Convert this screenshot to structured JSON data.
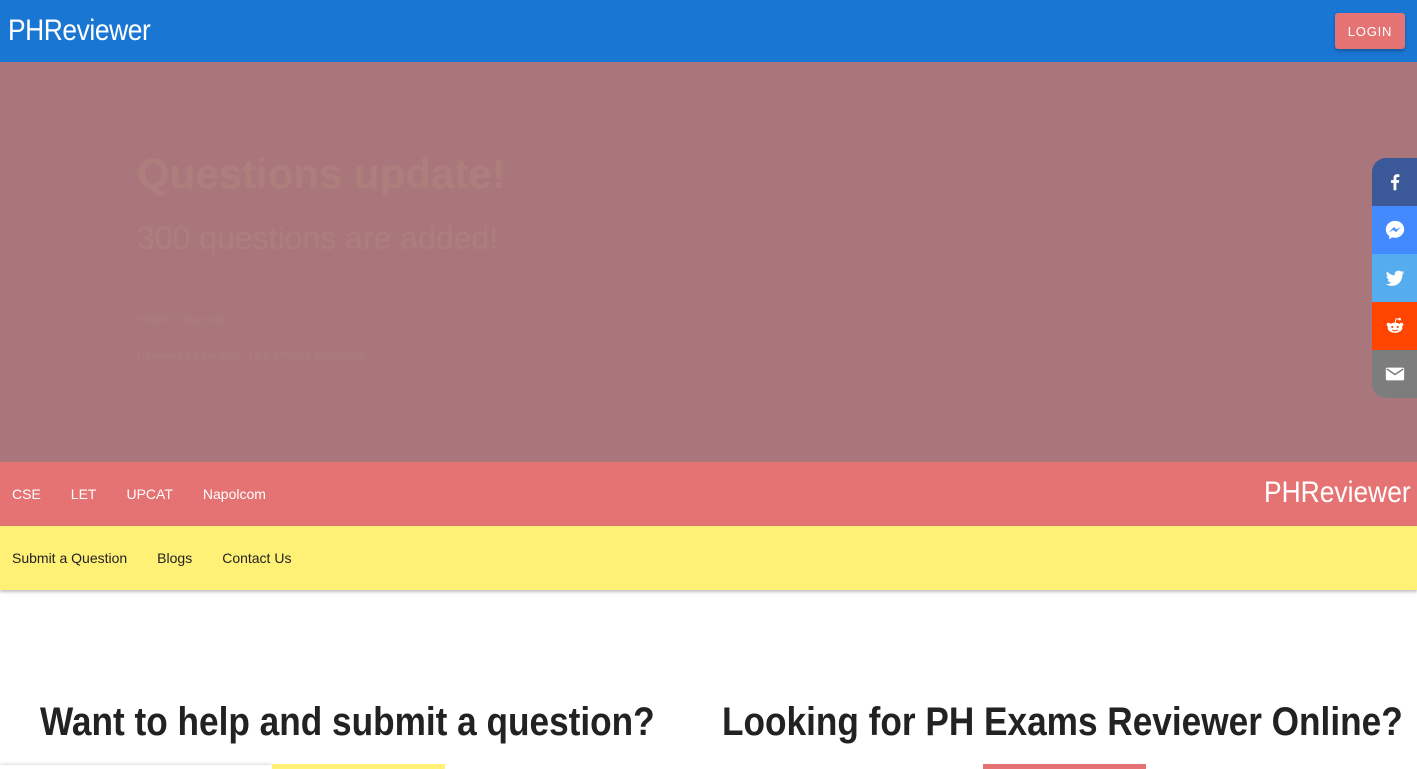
{
  "appbar": {
    "brand": "PHReviewer",
    "login_label": "LOGIN"
  },
  "hero": {
    "title": "Questions update!",
    "subtitle": "300 questions are added!",
    "line1": "Posted 2 days ago",
    "line2": "Reviewer for the CSE, LET, UPCAT, Napolcom"
  },
  "share": [
    {
      "name": "facebook",
      "color": "#3b5998"
    },
    {
      "name": "messenger",
      "color": "#448aff"
    },
    {
      "name": "twitter",
      "color": "#55acee"
    },
    {
      "name": "reddit",
      "color": "#ff4500"
    },
    {
      "name": "email",
      "color": "#7d7d7d"
    }
  ],
  "nav_primary": {
    "items": [
      "CSE",
      "LET",
      "UPCAT",
      "Napolcom"
    ],
    "brand": "PHReviewer"
  },
  "nav_secondary": {
    "items": [
      "Submit a Question",
      "Blogs",
      "Contact Us"
    ]
  },
  "main": {
    "left_heading": "Want to help and submit a question?",
    "right_heading": "Looking for PH Exams Reviewer Online?"
  },
  "colors": {
    "appbar": "#1976d2",
    "accent_red": "#e57373",
    "accent_yellow": "#fff176",
    "hero_bg": "#a9777b"
  }
}
